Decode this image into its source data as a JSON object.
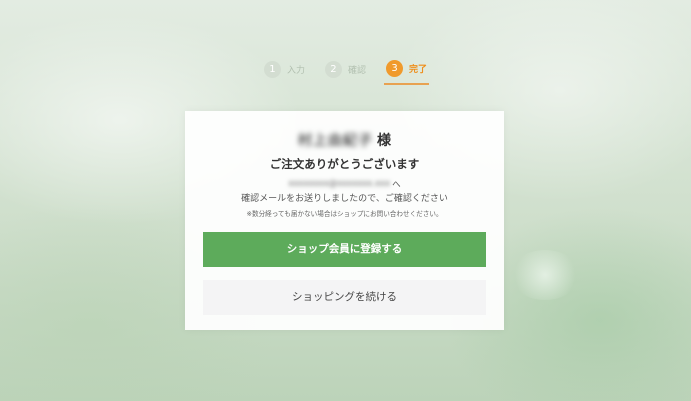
{
  "stepper": {
    "steps": [
      {
        "number": "1",
        "label": "入力"
      },
      {
        "number": "2",
        "label": "確認"
      },
      {
        "number": "3",
        "label": "完了"
      }
    ]
  },
  "card": {
    "customer_name": "村上由紀子",
    "honorific": "様",
    "thanks": "ご注文ありがとうございます",
    "email": "xxxxxxxx@xxxxxxx.xxx",
    "email_suffix": "へ",
    "confirmation_message": "確認メールをお送りしましたので、ご確認ください",
    "note": "※数分経っても届かない場合はショップにお問い合わせください。"
  },
  "buttons": {
    "register": "ショップ会員に登録する",
    "continue": "ショッピングを続ける"
  },
  "colors": {
    "accent_orange": "#f09a2c",
    "primary_green": "#5dab5b",
    "inactive_step": "#d3ddd1"
  }
}
